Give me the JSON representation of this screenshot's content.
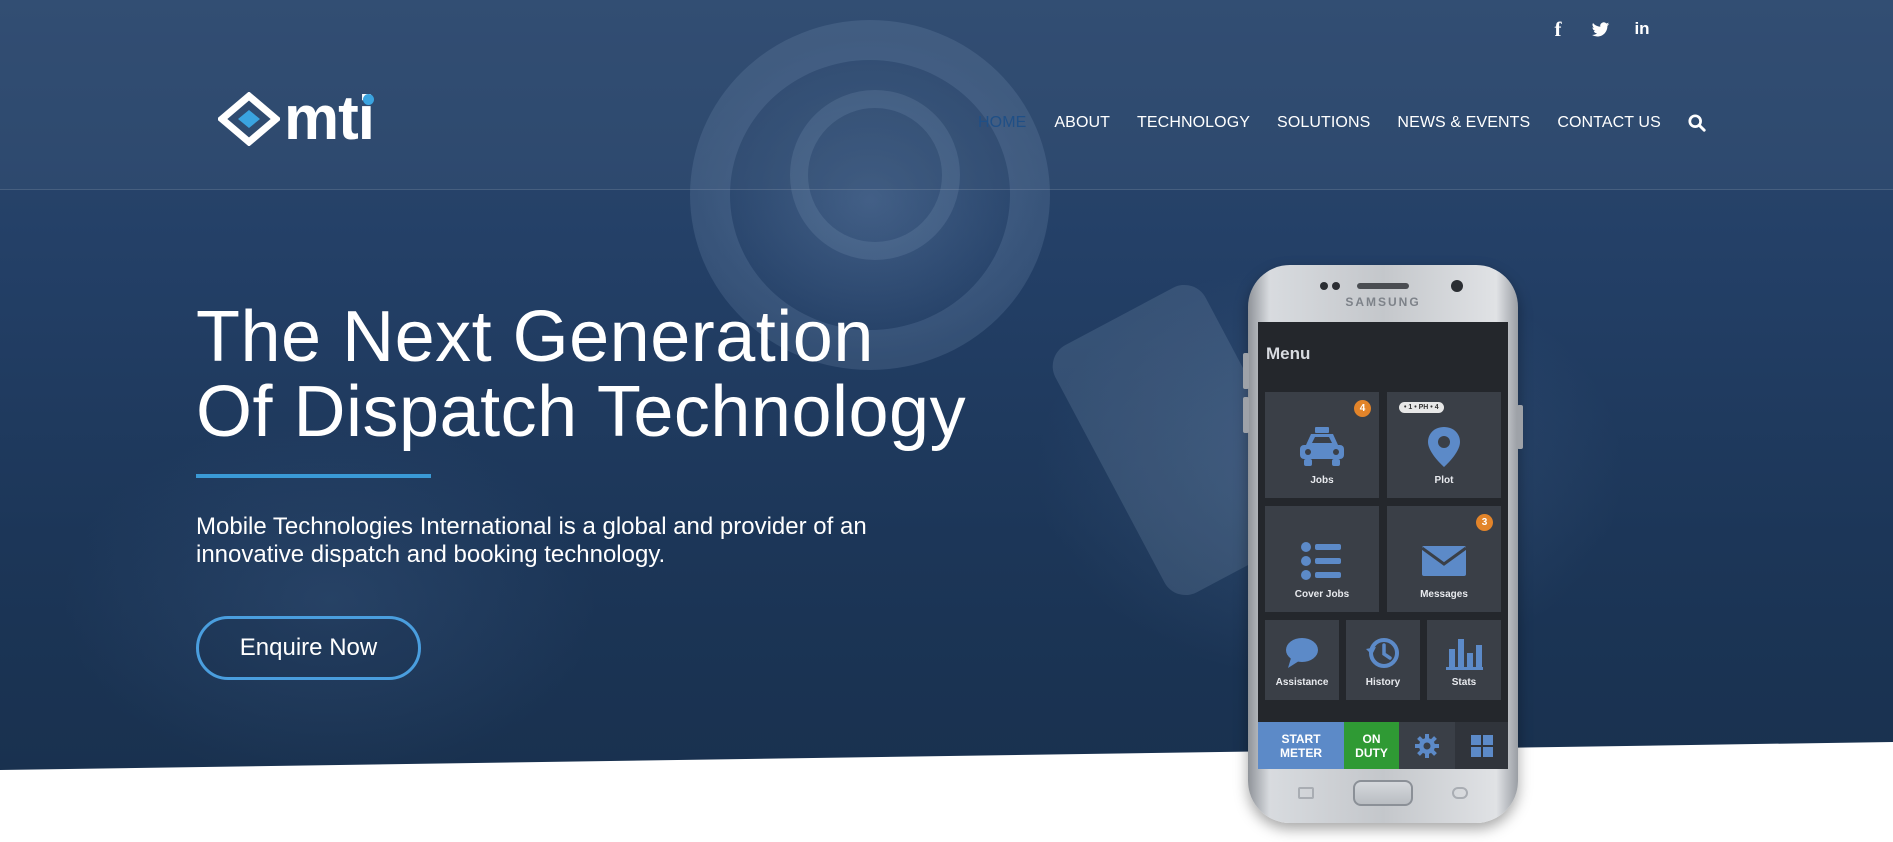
{
  "social": {
    "facebook": "f",
    "twitter": "twitter-icon",
    "linkedin": "in"
  },
  "logo": {
    "text": "mti"
  },
  "nav": {
    "items": [
      {
        "label": "HOME"
      },
      {
        "label": "ABOUT"
      },
      {
        "label": "TECHNOLOGY"
      },
      {
        "label": "SOLUTIONS"
      },
      {
        "label": "NEWS & EVENTS"
      },
      {
        "label": "CONTACT US"
      }
    ]
  },
  "hero": {
    "headline_line1": "The Next Generation",
    "headline_line2": "Of Dispatch Technology",
    "subtext": "Mobile Technologies International is a global and provider of an innovative dispatch and booking technology.",
    "cta_label": "Enquire Now"
  },
  "phone": {
    "brand": "SAMSUNG",
    "menu_title": "Menu",
    "bubble_text": "• 1 • PH • 4",
    "tiles": [
      {
        "label": "Jobs",
        "badge": "4"
      },
      {
        "label": "Plot",
        "badge": ""
      },
      {
        "label": "Cover Jobs",
        "badge": ""
      },
      {
        "label": "Messages",
        "badge": "3"
      },
      {
        "label": "Assistance"
      },
      {
        "label": "History"
      },
      {
        "label": "Stats"
      }
    ],
    "bottom": {
      "start_line1": "START",
      "start_line2": "METER",
      "duty_line1": "ON",
      "duty_line2": "DUTY"
    }
  },
  "colors": {
    "accent": "#3a9ad6",
    "nav_home": "#1f4f86",
    "badge": "#e2842a",
    "start_meter": "#5c8ac8",
    "on_duty": "#2f9a34"
  }
}
